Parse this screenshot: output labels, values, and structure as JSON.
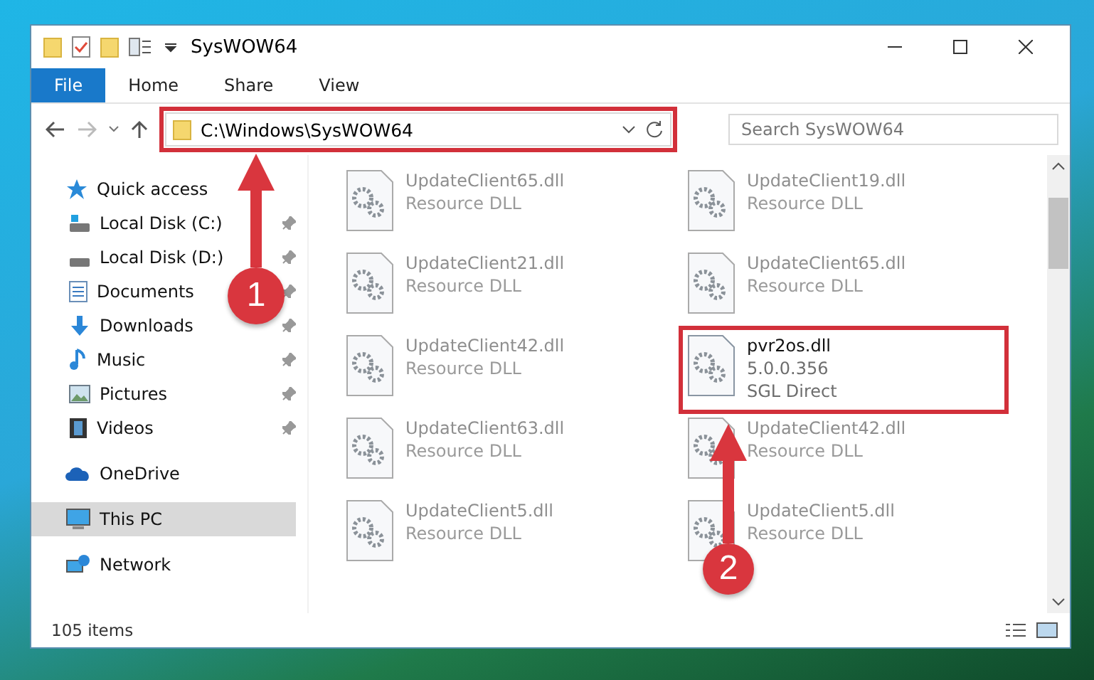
{
  "window": {
    "title": "SysWOW64"
  },
  "tabs": [
    {
      "label": "File",
      "selected": true
    },
    {
      "label": "Home",
      "selected": false
    },
    {
      "label": "Share",
      "selected": false
    },
    {
      "label": "View",
      "selected": false
    }
  ],
  "address": {
    "path": "C:\\Windows\\SysWOW64",
    "highlighted": true
  },
  "search": {
    "placeholder": "Search SysWOW64"
  },
  "sidebar": {
    "items": [
      {
        "label": "Quick access",
        "kind": "star",
        "selected": false,
        "children": [
          {
            "label": "Local Disk (C:)",
            "kind": "disk-c",
            "pinned": true,
            "selected": false
          },
          {
            "label": "Local Disk (D:)",
            "kind": "disk",
            "pinned": true,
            "selected": false
          },
          {
            "label": "Documents",
            "kind": "documents",
            "pinned": true,
            "selected": false
          },
          {
            "label": "Downloads",
            "kind": "downloads",
            "pinned": true,
            "selected": false
          },
          {
            "label": "Music",
            "kind": "music",
            "pinned": true,
            "selected": false
          },
          {
            "label": "Pictures",
            "kind": "pictures",
            "pinned": true,
            "selected": false
          },
          {
            "label": "Videos",
            "kind": "videos",
            "pinned": true,
            "selected": false
          }
        ]
      },
      {
        "label": "OneDrive",
        "kind": "cloud",
        "selected": false
      },
      {
        "label": "This PC",
        "kind": "pc",
        "selected": true
      },
      {
        "label": "Network",
        "kind": "network",
        "selected": false
      }
    ]
  },
  "files": [
    {
      "name": "UpdateClient65.dll",
      "lines": [
        "Resource DLL"
      ],
      "kind": "blurred",
      "highlighted": false
    },
    {
      "name": "UpdateClient19.dll",
      "lines": [
        "Resource DLL"
      ],
      "kind": "blurred",
      "highlighted": false
    },
    {
      "name": "UpdateClient21.dll",
      "lines": [
        "Resource DLL"
      ],
      "kind": "blurred",
      "highlighted": false
    },
    {
      "name": "UpdateClient65.dll",
      "lines": [
        "Resource DLL"
      ],
      "kind": "blurred",
      "highlighted": false
    },
    {
      "name": "UpdateClient42.dll",
      "lines": [
        "Resource DLL"
      ],
      "kind": "blurred",
      "highlighted": false
    },
    {
      "name": "pvr2os.dll",
      "lines": [
        "5.0.0.356",
        "SGL Direct"
      ],
      "kind": "clear",
      "highlighted": true
    },
    {
      "name": "UpdateClient63.dll",
      "lines": [
        "Resource DLL"
      ],
      "kind": "blurred",
      "highlighted": false
    },
    {
      "name": "UpdateClient42.dll",
      "lines": [
        "Resource DLL"
      ],
      "kind": "blurred",
      "highlighted": false
    },
    {
      "name": "UpdateClient5.dll",
      "lines": [
        "Resource DLL"
      ],
      "kind": "blurred",
      "highlighted": false
    },
    {
      "name": "UpdateClient5.dll",
      "lines": [
        "Resource DLL"
      ],
      "kind": "blurred",
      "highlighted": false
    }
  ],
  "status_bar": {
    "count": "105 items"
  },
  "annotations": [
    {
      "label": "1"
    },
    {
      "label": "2"
    }
  ]
}
